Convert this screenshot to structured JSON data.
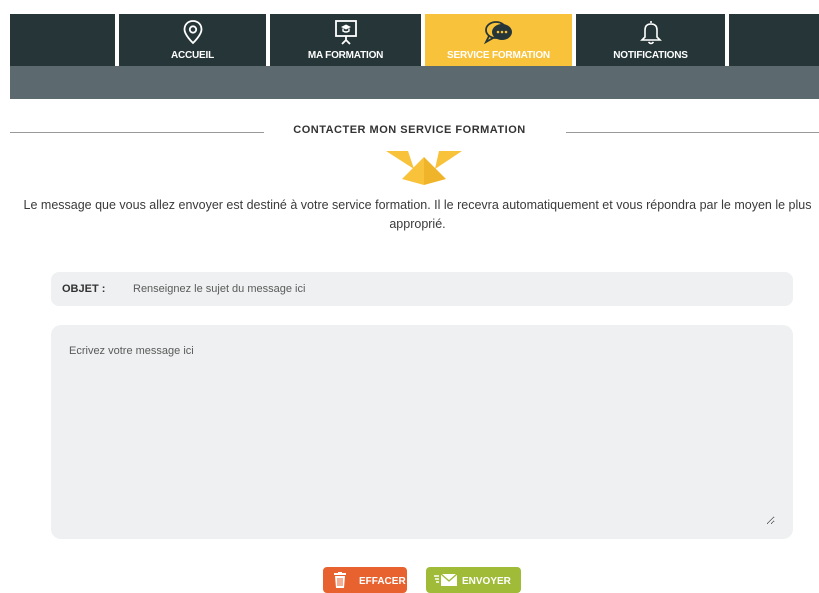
{
  "nav": {
    "tabs": [
      {
        "label": "ACCUEIL",
        "icon": "location-pin-icon",
        "active": false
      },
      {
        "label": "MA FORMATION",
        "icon": "presentation-board-icon",
        "active": false
      },
      {
        "label": "SERVICE FORMATION",
        "icon": "chat-bubbles-icon",
        "active": true
      },
      {
        "label": "NOTIFICATIONS",
        "icon": "bell-icon",
        "active": false
      }
    ]
  },
  "page": {
    "heading": "CONTACTER MON SERVICE FORMATION",
    "intro": "Le message que vous allez envoyer est destiné à votre service formation. Il le recevra automatiquement et vous répondra par le moyen le plus approprié."
  },
  "form": {
    "subject_label": "OBJET :",
    "subject_placeholder": "Renseignez le sujet du message ici",
    "message_placeholder": "Ecrivez votre message ici"
  },
  "buttons": {
    "clear_label": "EFFACER",
    "send_label": "ENVOYER"
  },
  "colors": {
    "nav_bg": "#263638",
    "nav_active": "#f8c23a",
    "subbar": "#5c6a70",
    "clear_button": "#e8622f",
    "send_button": "#9fbb37",
    "field_bg": "#eef0f1"
  }
}
